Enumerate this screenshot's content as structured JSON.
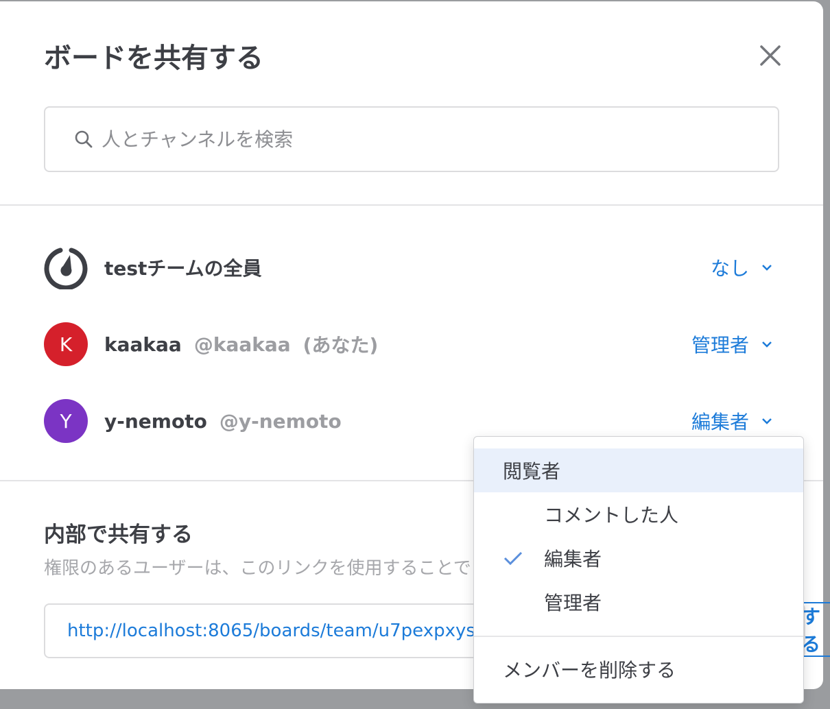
{
  "dialog": {
    "title": "ボードを共有する",
    "search_placeholder": "人とチャンネルを検索"
  },
  "members": [
    {
      "name": "testチームの全員",
      "handle": "",
      "suffix": "",
      "role": "なし",
      "avatar": "mattermost-logo-icon"
    },
    {
      "name": "kaakaa",
      "handle": "@kaakaa",
      "suffix": "(あなた)",
      "role": "管理者",
      "avatar_letter": "K",
      "avatar_color": "#d5202b"
    },
    {
      "name": "y-nemoto",
      "handle": "@y-nemoto",
      "suffix": "",
      "role": "編集者",
      "avatar_letter": "Y",
      "avatar_color": "#7b34c4"
    }
  ],
  "internal_share": {
    "title": "内部で共有する",
    "description": "権限のあるユーザーは、このリンクを使用することで",
    "url": "http://localhost:8065/boards/team/u7pexpxys",
    "copy_label": "する"
  },
  "role_menu": {
    "items": [
      "閲覧者",
      "コメントした人",
      "編集者",
      "管理者"
    ],
    "selected": "編集者",
    "hovered": "閲覧者",
    "remove_label": "メンバーを削除する"
  },
  "colors": {
    "link_blue": "#1c7bd9",
    "hover_bg": "#e9f0fb",
    "text_dark": "#3d3f45"
  }
}
